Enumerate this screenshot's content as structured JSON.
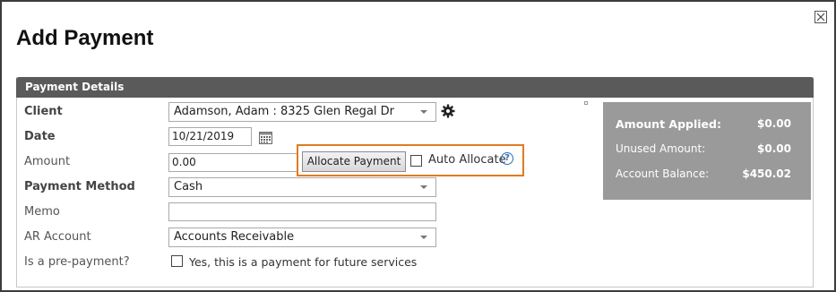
{
  "dialog": {
    "title": "Add Payment"
  },
  "panel": {
    "header": "Payment Details"
  },
  "form": {
    "client_label": "Client",
    "client_value": "Adamson, Adam : 8325 Glen Regal Dr",
    "date_label": "Date",
    "date_value": "10/21/2019",
    "amount_label": "Amount",
    "amount_value": "0.00",
    "allocate_button": "Allocate Payment",
    "auto_allocate_label": "Auto Allocate",
    "payment_method_label": "Payment Method",
    "payment_method_value": "Cash",
    "memo_label": "Memo",
    "memo_value": "",
    "ar_account_label": "AR Account",
    "ar_account_value": "Accounts Receivable",
    "prepayment_label": "Is a pre-payment?",
    "prepayment_checkbox_label": "Yes, this is a payment for future services"
  },
  "summary": {
    "amount_applied_label": "Amount Applied:",
    "amount_applied_value": "$0.00",
    "unused_amount_label": "Unused Amount:",
    "unused_amount_value": "$0.00",
    "account_balance_label": "Account Balance:",
    "account_balance_value": "$450.02"
  },
  "colors": {
    "header_bg": "#5a5a5a",
    "summary_bg": "#9a9a9a",
    "highlight_border": "#e07b20",
    "help_icon": "#2a6fb8"
  }
}
